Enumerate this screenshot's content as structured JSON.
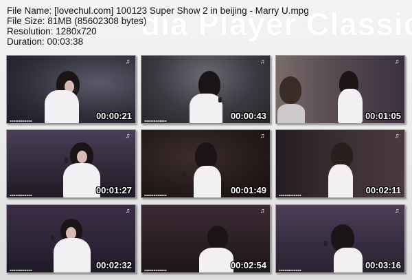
{
  "watermark": "dia Player Classic",
  "info": {
    "file_name": "File Name: [lovechul.com] 100123 Super Show 2 in beijing - Marry U.mpg",
    "file_size": "File Size: 81MB (85602308 bytes)",
    "resolution": "Resolution: 1280x720",
    "duration": "Duration: 00:03:38"
  },
  "thumbnails": [
    {
      "time": "00:00:21"
    },
    {
      "time": "00:00:43"
    },
    {
      "time": "00:01:05"
    },
    {
      "time": "00:01:27"
    },
    {
      "time": "00:01:49"
    },
    {
      "time": "00:02:11"
    },
    {
      "time": "00:02:32"
    },
    {
      "time": "00:02:54"
    },
    {
      "time": "00:03:16"
    }
  ]
}
